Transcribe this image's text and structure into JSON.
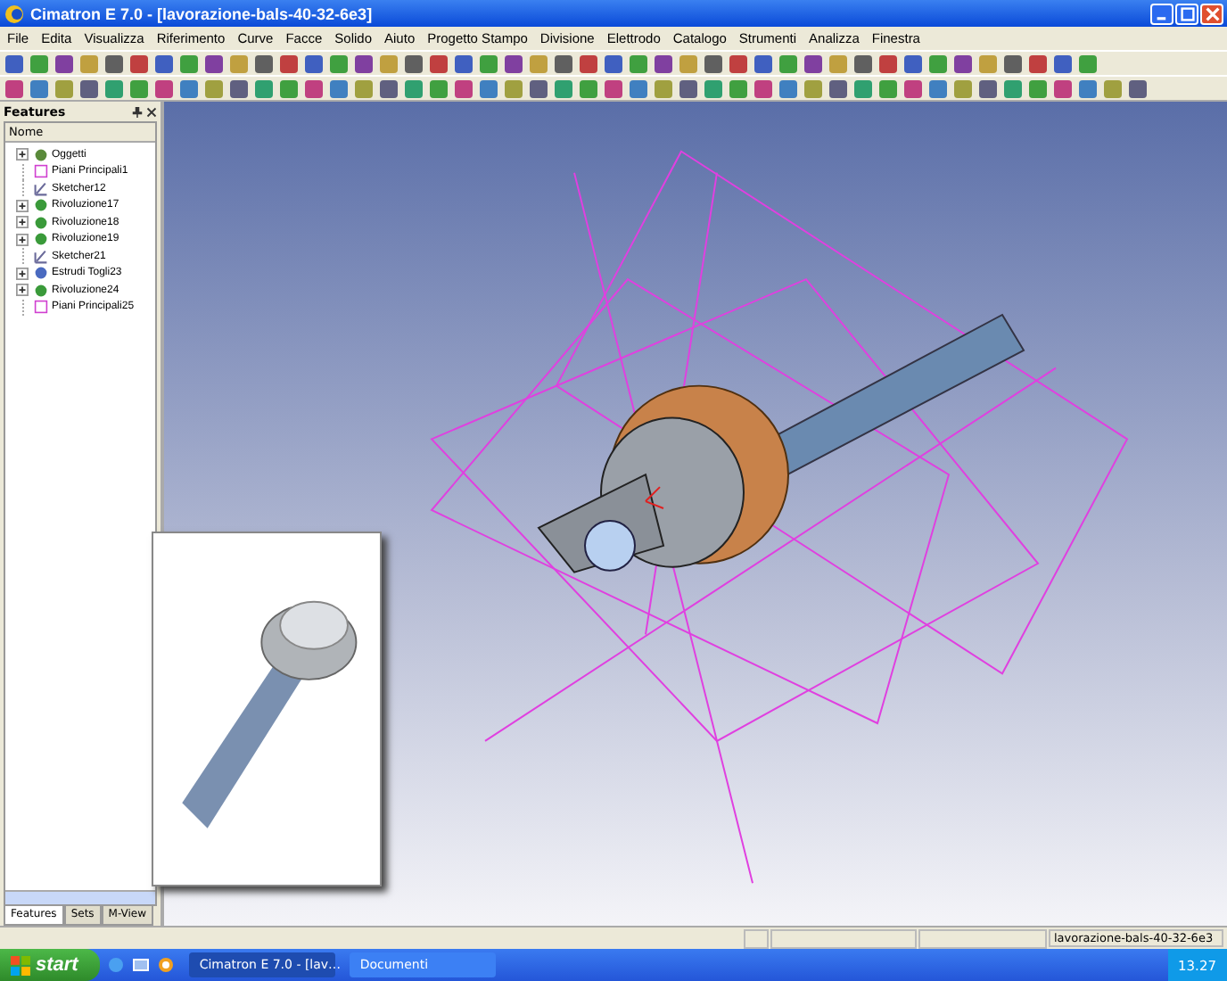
{
  "window": {
    "title": "Cimatron E 7.0 - [lavorazione-bals-40-32-6e3]"
  },
  "menu": [
    "File",
    "Edita",
    "Visualizza",
    "Riferimento",
    "Curve",
    "Facce",
    "Solido",
    "Aiuto",
    "Progetto Stampo",
    "Divisione",
    "Elettrodo",
    "Catalogo",
    "Strumenti",
    "Analizza",
    "Finestra"
  ],
  "features_panel": {
    "title": "Features",
    "column": "Nome",
    "items": [
      {
        "label": "Oggetti",
        "kind": "objects",
        "expandable": true
      },
      {
        "label": "Piani Principali1",
        "kind": "plane",
        "expandable": false
      },
      {
        "label": "Sketcher12",
        "kind": "sketch",
        "expandable": false
      },
      {
        "label": "Rivoluzione17",
        "kind": "revolve",
        "expandable": true
      },
      {
        "label": "Rivoluzione18",
        "kind": "revolve",
        "expandable": true
      },
      {
        "label": "Rivoluzione19",
        "kind": "revolve",
        "expandable": true
      },
      {
        "label": "Sketcher21",
        "kind": "sketch",
        "expandable": false
      },
      {
        "label": "Estrudi Togli23",
        "kind": "extrude",
        "expandable": true
      },
      {
        "label": "Rivoluzione24",
        "kind": "revolve",
        "expandable": true
      },
      {
        "label": "Piani Principali25",
        "kind": "plane",
        "expandable": false
      }
    ],
    "tabs": [
      {
        "label": "Features",
        "selected": true
      },
      {
        "label": "Sets",
        "selected": false
      },
      {
        "label": "M-View",
        "selected": false
      }
    ]
  },
  "status_bar": {
    "document": "lavorazione-bals-40-32-6e3"
  },
  "taskbar": {
    "start": "start",
    "tasks": [
      {
        "label": "Cimatron E 7.0 - [lav…",
        "selected": true
      },
      {
        "label": "Documenti",
        "selected": false
      }
    ],
    "clock": "13.27"
  }
}
